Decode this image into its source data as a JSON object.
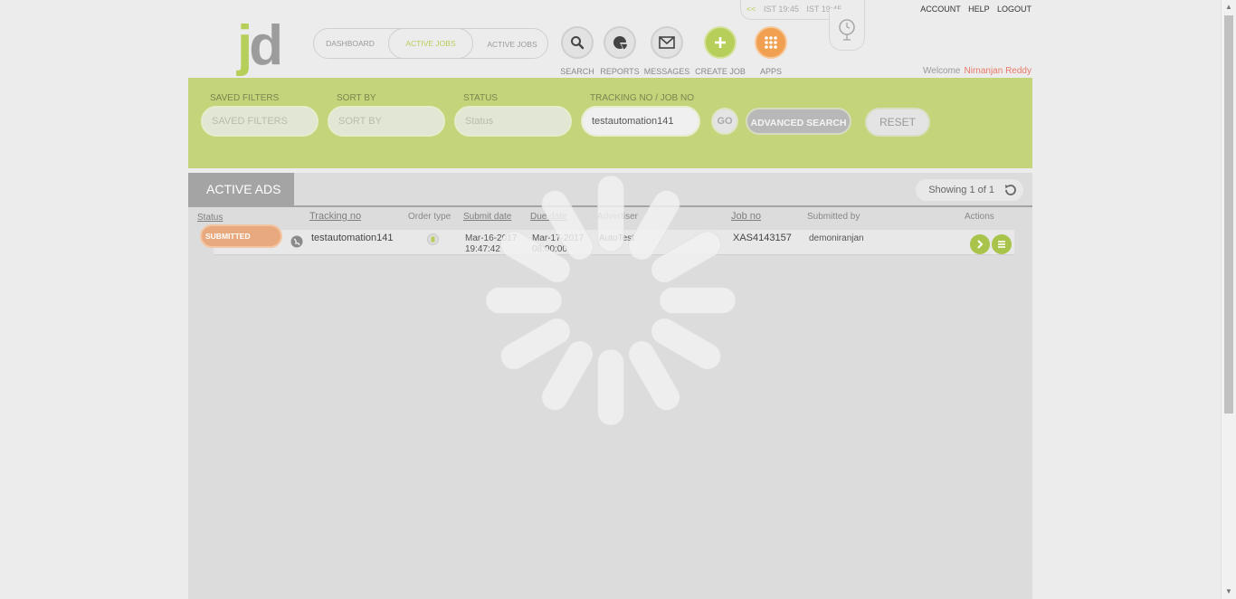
{
  "logo": {
    "j": "j",
    "d": "d"
  },
  "nav": {
    "tabs": [
      {
        "label": "DASHBOARD",
        "active": false
      },
      {
        "label": "ACTIVE JOBS",
        "active": true
      },
      {
        "label": "ACTIVE JOBS",
        "active": false
      }
    ]
  },
  "tools": [
    {
      "label": "SEARCH",
      "icon": "search-icon"
    },
    {
      "label": "REPORTS",
      "icon": "reports-icon"
    },
    {
      "label": "MESSAGES",
      "icon": "messages-icon"
    },
    {
      "label": "CREATE JOB",
      "icon": "plus-icon"
    },
    {
      "label": "APPS",
      "icon": "apps-grid-icon"
    }
  ],
  "clock": {
    "back": "<<",
    "time1": "IST 19:45",
    "time2": "IST 19:45"
  },
  "top_links": {
    "account": "ACCOUNT",
    "help": "HELP",
    "logout": "LOGOUT"
  },
  "welcome": {
    "prefix": "Welcome",
    "user": "Nirnanjan Reddy"
  },
  "filters": {
    "saved_filters": {
      "label": "SAVED FILTERS",
      "placeholder": "SAVED FILTERS"
    },
    "sort_by": {
      "label": "SORT BY",
      "placeholder": "SORT BY"
    },
    "status": {
      "label": "STATUS",
      "placeholder": "Status"
    },
    "tracking": {
      "label": "TRACKING NO / JOB NO",
      "value": "testautomation141"
    },
    "go": "GO",
    "advanced": "ADVANCED SEARCH",
    "reset": "RESET"
  },
  "panel": {
    "tab": "ACTIVE ADS",
    "showing": "Showing 1 of 1"
  },
  "table": {
    "headers": {
      "status": "Status",
      "tracking": "Tracking no",
      "order_type": "Order type",
      "submit_date": "Submit date",
      "due_date": "Due date",
      "advertiser": "Advertiser",
      "job_no": "Job no",
      "submitted_by": "Submitted by",
      "actions": "Actions"
    },
    "rows": [
      {
        "status": "SUBMITTED",
        "tracking": "testautomation141",
        "submit_date": "Mar-16-2017",
        "submit_time": "19:47:42",
        "due_date": "Mar-17-2017",
        "due_time": "08:00:00",
        "advertiser": "AutoTest",
        "job_no": "XAS4143157",
        "submitted_by": "demoniranjan"
      }
    ]
  },
  "colors": {
    "accent_green": "#b6cf5b",
    "filter_bar": "#c3d47a",
    "status_submitted": "#e9a97e",
    "apps_orange": "#f0a050",
    "welcome_user": "#e8796a"
  }
}
